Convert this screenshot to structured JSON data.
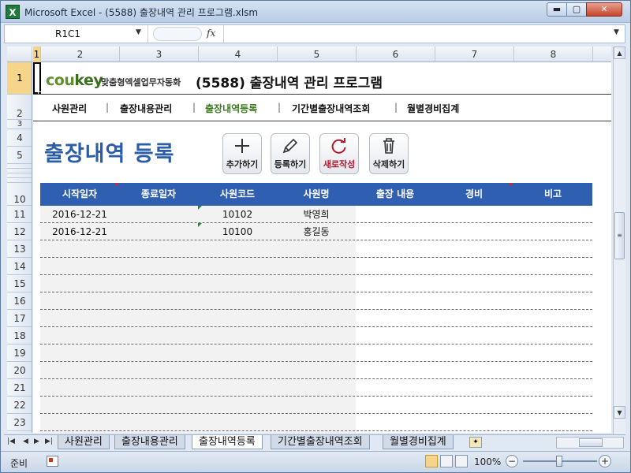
{
  "window": {
    "icon_letter": "X",
    "title": "Microsoft Excel - (5588) 출장내역 관리 프로그램.xlsm",
    "minimize": "▬",
    "maximize": "▢",
    "close": "✕"
  },
  "formula_bar": {
    "name_box": "R1C1",
    "name_arrow": "▼",
    "fx": "fx",
    "formula": "",
    "expand": "▼"
  },
  "columns": [
    "1",
    "2",
    "3",
    "4",
    "5",
    "6",
    "7",
    "8"
  ],
  "rows": [
    "1",
    "2",
    "3",
    "4",
    "5",
    "10",
    "11",
    "12",
    "13",
    "14",
    "15",
    "16",
    "17",
    "18",
    "19",
    "20",
    "21",
    "22",
    "23"
  ],
  "brand": {
    "logo_main": "cou",
    "logo_accent": "key",
    "tagline": "맞춤형엑셀업무자동화",
    "title": "(5588) 출장내역 관리 프로그램"
  },
  "nav": {
    "items": [
      "사원관리",
      "출장내용관리",
      "출장내역등록",
      "기간별출장내역조회",
      "월별경비집계"
    ],
    "separator": "|",
    "current": "출장내역등록"
  },
  "section": {
    "title": "출장내역 등록"
  },
  "actions": {
    "add": "추가하기",
    "register": "등록하기",
    "new": "새로작성",
    "delete": "삭제하기"
  },
  "table": {
    "headers": [
      "시작일자",
      "종료일자",
      "사원코드",
      "사원명",
      "출장 내용",
      "경비",
      "비고"
    ],
    "rows": [
      [
        "2016-12-21",
        "",
        "10102",
        "박영희",
        "",
        "",
        ""
      ],
      [
        "2016-12-21",
        "",
        "10100",
        "홍길동",
        "",
        "",
        ""
      ]
    ]
  },
  "sheet_tabs": {
    "nav_first": "|◀",
    "nav_prev": "◀",
    "nav_next": "▶",
    "nav_last": "▶|",
    "tabs": [
      "사원관리",
      "출장내용관리",
      "출장내역등록",
      "기간별출장내역조회",
      "월별경비집계"
    ],
    "active": "출장내역등록"
  },
  "status": {
    "mode": "준비",
    "zoom": "100%",
    "zoom_minus": "−",
    "zoom_plus": "+"
  },
  "colors": {
    "accent_blue": "#2f5fb0",
    "title_blue": "#2b5ca8",
    "nav_current_green": "#3c7a1e",
    "new_button_red": "#b3172b"
  }
}
